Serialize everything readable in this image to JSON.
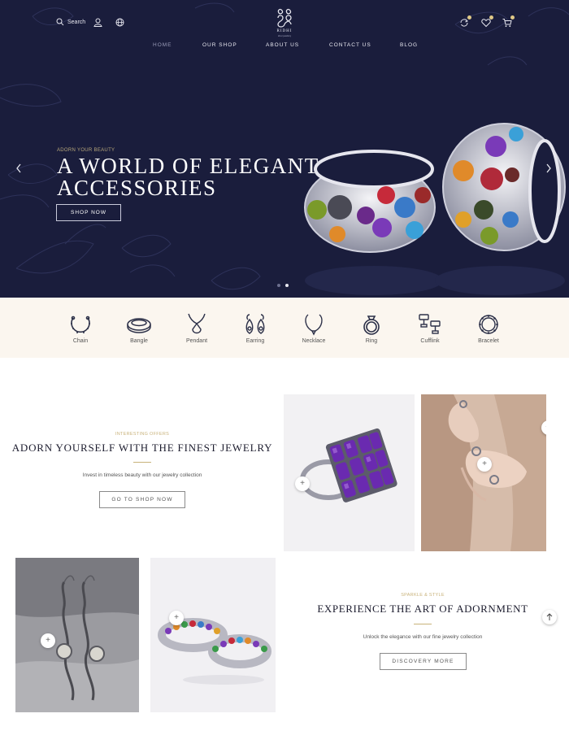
{
  "header": {
    "search_label": "Search",
    "logo_text": "RIDHI",
    "logo_subtext": "silver jewellery",
    "icons": [
      "search-icon",
      "user-icon",
      "globe-icon",
      "refresh-icon",
      "heart-icon",
      "cart-icon"
    ],
    "badge_color": "#e0c987"
  },
  "nav": {
    "items": [
      {
        "label": "HOME",
        "active": true
      },
      {
        "label": "OUR SHOP",
        "active": false
      },
      {
        "label": "ABOUT US",
        "active": false
      },
      {
        "label": "CONTACT US",
        "active": false
      },
      {
        "label": "BLOG",
        "active": false
      }
    ]
  },
  "hero": {
    "kicker": "ADORN YOUR BEAUTY",
    "title_line1": "A WORLD OF ELEGANT",
    "title_line2": "ACCESSORIES",
    "button": "SHOP NOW",
    "background": "#1a1d3c",
    "slides": 2,
    "active_slide": 2
  },
  "categories": [
    {
      "label": "Chain",
      "icon": "chain-icon"
    },
    {
      "label": "Bangle",
      "icon": "bangle-icon"
    },
    {
      "label": "Pendant",
      "icon": "pendant-icon"
    },
    {
      "label": "Earring",
      "icon": "earring-icon"
    },
    {
      "label": "Necklace",
      "icon": "necklace-icon"
    },
    {
      "label": "Ring",
      "icon": "ring-icon"
    },
    {
      "label": "Cufflink",
      "icon": "cufflink-icon"
    },
    {
      "label": "Bracelet",
      "icon": "bracelet-icon"
    }
  ],
  "promo1": {
    "kicker": "INTERESTING OFFERS",
    "title": "ADORN YOURSELF WITH THE FINEST JEWELRY",
    "subtitle": "Invest in timeless beauty with our jewelry collection",
    "button": "GO TO SHOP NOW"
  },
  "promo2": {
    "kicker": "SPARKLE & STYLE",
    "title": "EXPERIENCE THE ART OF ADORNMENT",
    "subtitle": "Unlock the elegance with our fine jewelry collection",
    "button": "DISCOVERY MORE"
  },
  "colors": {
    "accent_gold": "#c8b27a",
    "navy": "#1a1d3c",
    "cream": "#fbf6ef"
  }
}
